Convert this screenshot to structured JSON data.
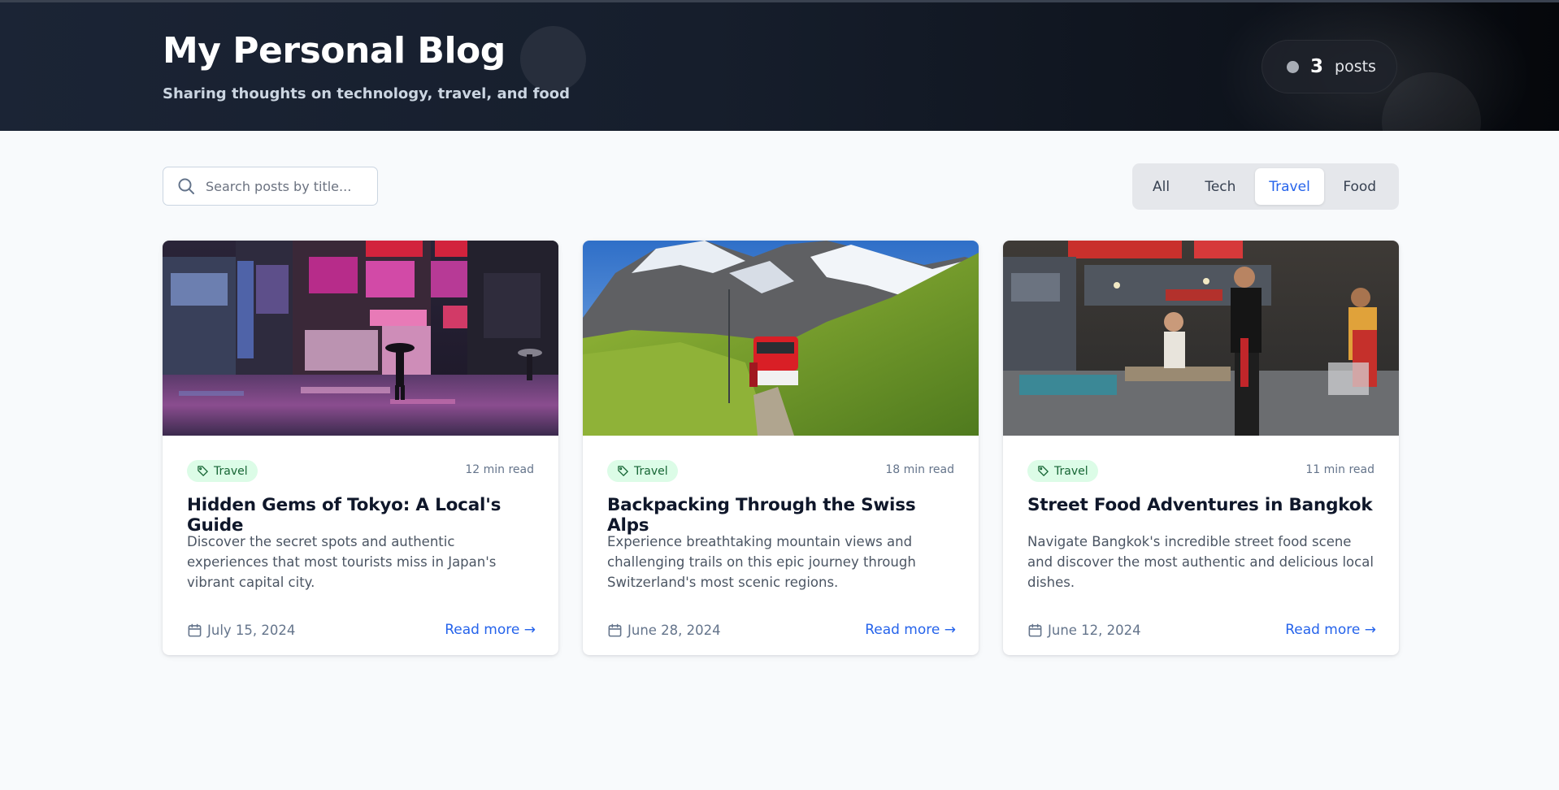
{
  "header": {
    "title": "My Personal Blog",
    "subtitle": "Sharing thoughts on technology, travel, and food",
    "posts_count": "3",
    "posts_label": "posts"
  },
  "search": {
    "placeholder": "Search posts by title..."
  },
  "filters": {
    "tabs": [
      {
        "label": "All"
      },
      {
        "label": "Tech"
      },
      {
        "label": "Travel"
      },
      {
        "label": "Food"
      }
    ],
    "active": "Travel"
  },
  "posts": [
    {
      "image": "neon-tokyo-street-photo",
      "tag": "Travel",
      "read_time": "12 min read",
      "title": "Hidden Gems of Tokyo: A Local's Guide",
      "excerpt": "Discover the secret spots and authentic experiences that most tourists miss in Japan's vibrant capital city.",
      "date": "July 15, 2024",
      "read_more": "Read more →"
    },
    {
      "image": "swiss-alps-train-photo",
      "tag": "Travel",
      "read_time": "18 min read",
      "title": "Backpacking Through the Swiss Alps",
      "excerpt": "Experience breathtaking mountain views and challenging trails on this epic journey through Switzerland's most scenic regions.",
      "date": "June 28, 2024",
      "read_more": "Read more →"
    },
    {
      "image": "bangkok-street-food-stall-photo",
      "tag": "Travel",
      "read_time": "11 min read",
      "title": "Street Food Adventures in Bangkok",
      "excerpt": "Navigate Bangkok's incredible street food scene and discover the most authentic and delicious local dishes.",
      "date": "June 12, 2024",
      "read_more": "Read more →"
    }
  ],
  "colors": {
    "accent": "#2563eb",
    "tag_bg": "#dcfce7",
    "tag_text": "#166534",
    "header_bg": "#161e2c",
    "page_bg": "#f8fafc"
  }
}
